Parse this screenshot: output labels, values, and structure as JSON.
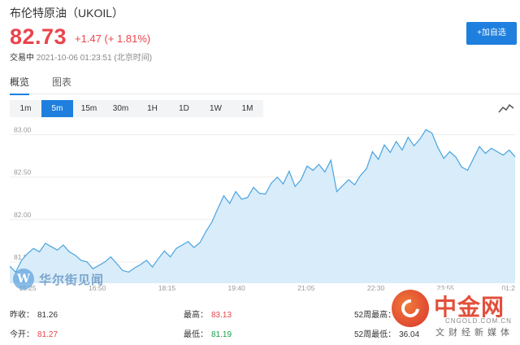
{
  "header": {
    "title": "布伦特原油（UKOIL）",
    "price": "82.73",
    "change": "+1.47 (+ 1.81%)",
    "status_label": "交易中",
    "timestamp": "2021-10-06 01:23:51 (北京时间)",
    "add_button": "+加自选"
  },
  "tabs": [
    {
      "label": "概览",
      "active": true
    },
    {
      "label": "图表",
      "active": false
    }
  ],
  "intervals": [
    {
      "label": "1m",
      "active": false
    },
    {
      "label": "5m",
      "active": true
    },
    {
      "label": "15m",
      "active": false
    },
    {
      "label": "30m",
      "active": false
    },
    {
      "label": "1H",
      "active": false
    },
    {
      "label": "1D",
      "active": false
    },
    {
      "label": "1W",
      "active": false
    },
    {
      "label": "1M",
      "active": false
    }
  ],
  "chart_type_icon": "line-chart-icon",
  "chart_data": {
    "type": "area",
    "x_ticks": [
      "15:25",
      "16:50",
      "18:15",
      "19:40",
      "21:05",
      "22:30",
      "23:55",
      "01:2"
    ],
    "y_ticks": [
      "83.00",
      "82.50",
      "82.00",
      "81.50"
    ],
    "ylim": [
      81.25,
      83.13
    ],
    "color": "#4aa3df",
    "fill": "#d8ecf9",
    "series": [
      {
        "values": [
          81.45,
          81.38,
          81.52,
          81.6,
          81.66,
          81.62,
          81.72,
          81.68,
          81.64,
          81.7,
          81.62,
          81.58,
          81.52,
          81.5,
          81.42,
          81.46,
          81.5,
          81.56,
          81.48,
          81.4,
          81.38,
          81.43,
          81.47,
          81.52,
          81.44,
          81.54,
          81.63,
          81.56,
          81.66,
          81.7,
          81.74,
          81.67,
          81.73,
          81.86,
          81.97,
          82.13,
          82.28,
          82.19,
          82.33,
          82.24,
          82.26,
          82.38,
          82.31,
          82.3,
          82.43,
          82.5,
          82.42,
          82.57,
          82.39,
          82.47,
          82.63,
          82.58,
          82.65,
          82.56,
          82.7,
          82.33,
          82.4,
          82.47,
          82.41,
          82.52,
          82.6,
          82.8,
          82.71,
          82.88,
          82.79,
          82.92,
          82.82,
          82.97,
          82.87,
          82.95,
          83.06,
          83.02,
          82.85,
          82.72,
          82.8,
          82.74,
          82.62,
          82.58,
          82.72,
          82.86,
          82.78,
          82.84,
          82.8,
          82.76,
          82.82,
          82.74
        ]
      }
    ]
  },
  "stats": [
    {
      "label": "昨收：",
      "value": "81.26",
      "color": "#333333"
    },
    {
      "label": "最高：",
      "value": "83.13",
      "color": "#e9454b"
    },
    {
      "label": "52周最高：",
      "value": "",
      "color": "#333333"
    },
    {
      "label": "今开：",
      "value": "81.27",
      "color": "#e9454b"
    },
    {
      "label": "最低：",
      "value": "81.19",
      "color": "#1a9e4b"
    },
    {
      "label": "52周最低：",
      "value": "36.04",
      "color": "#333333"
    }
  ],
  "watermarks": {
    "left_logo_letter": "W",
    "left_text": "华尔街见闻",
    "right_cn": "中金网",
    "right_url": "CNGOLD.COM.CN",
    "right_sub": "文财经新媒体"
  }
}
